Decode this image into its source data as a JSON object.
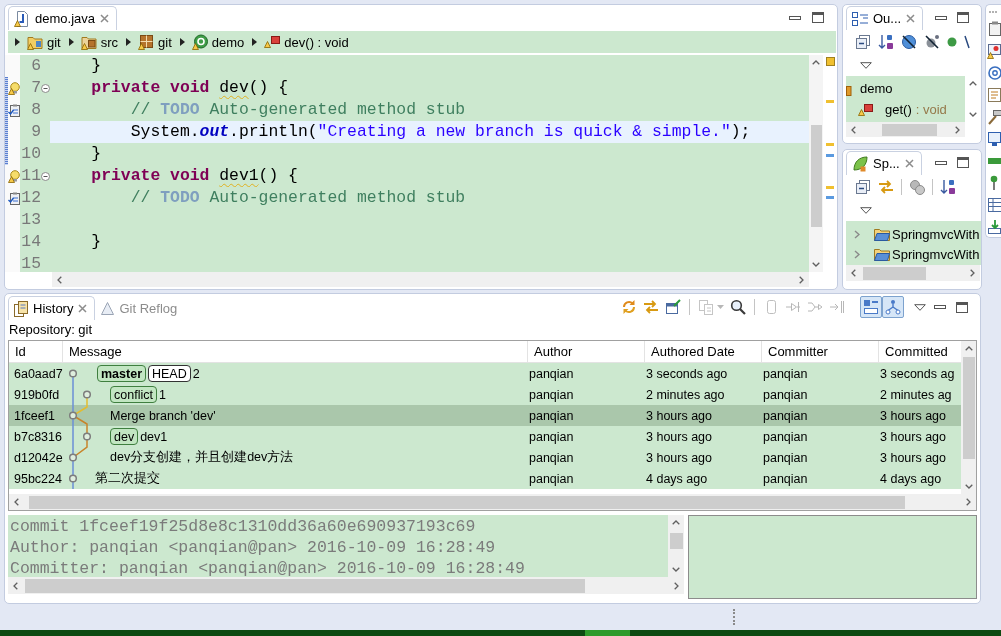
{
  "editor": {
    "tab": {
      "title": "demo.java",
      "selected": true
    },
    "breadcrumb": [
      {
        "kind": "project",
        "label": "git"
      },
      {
        "kind": "source-folder",
        "label": "src"
      },
      {
        "kind": "package",
        "label": "git"
      },
      {
        "kind": "class",
        "label": "demo"
      },
      {
        "kind": "method",
        "label": "dev() : void"
      }
    ],
    "lines": [
      {
        "number": "6",
        "current": false,
        "changed": false,
        "tokens": [
          {
            "kind": "plain",
            "text": "    }"
          }
        ]
      },
      {
        "number": "7",
        "current": false,
        "changed": true,
        "marks": [
          {
            "kind": "warning"
          },
          {
            "kind": "collapse"
          }
        ],
        "tokens": [
          {
            "kind": "keyword",
            "text": "    private void "
          },
          {
            "kind": "warning",
            "text": "dev"
          },
          {
            "kind": "plain",
            "text": "() {"
          }
        ]
      },
      {
        "number": "8",
        "current": false,
        "changed": true,
        "marks": [
          {
            "kind": "task"
          }
        ],
        "tokens": [
          {
            "kind": "comment",
            "text": "        // "
          },
          {
            "kind": "todo",
            "text": "TODO"
          },
          {
            "kind": "comment",
            "text": " Auto-generated method stub"
          }
        ]
      },
      {
        "number": "9",
        "current": true,
        "changed": true,
        "tokens": [
          {
            "kind": "plain",
            "text": "        System."
          },
          {
            "kind": "field",
            "text": "out"
          },
          {
            "kind": "plain",
            "text": ".println("
          },
          {
            "kind": "string",
            "text": "\"Creating a new branch is quick & simple.\""
          },
          {
            "kind": "plain",
            "text": ");"
          }
        ]
      },
      {
        "number": "10",
        "current": false,
        "changed": true,
        "tokens": [
          {
            "kind": "plain",
            "text": "    }"
          }
        ]
      },
      {
        "number": "11",
        "current": false,
        "changed": false,
        "marks": [
          {
            "kind": "warning"
          },
          {
            "kind": "collapse"
          }
        ],
        "tokens": [
          {
            "kind": "keyword",
            "text": "    private void "
          },
          {
            "kind": "warning",
            "text": "dev1"
          },
          {
            "kind": "plain",
            "text": "() {"
          }
        ]
      },
      {
        "number": "12",
        "current": false,
        "changed": false,
        "marks": [
          {
            "kind": "task"
          }
        ],
        "tokens": [
          {
            "kind": "comment",
            "text": "        // "
          },
          {
            "kind": "todo",
            "text": "TODO"
          },
          {
            "kind": "comment",
            "text": " Auto-generated method stub"
          }
        ]
      },
      {
        "number": "13",
        "current": false,
        "changed": false
      },
      {
        "number": "14",
        "current": false,
        "changed": false,
        "tokens": [
          {
            "kind": "plain",
            "text": "    }"
          }
        ]
      },
      {
        "number": "15",
        "current": false,
        "changed": false
      }
    ]
  },
  "outline": {
    "title": "Ou...",
    "items": [
      {
        "kind": "class",
        "name": "demo",
        "children": [
          {
            "kind": "method",
            "name": "get()",
            "type": ": void"
          }
        ]
      }
    ]
  },
  "spring_explorer": {
    "title": "Sp...",
    "items": [
      {
        "label": "SpringmvcWith",
        "expanded": false
      },
      {
        "label": "SpringmvcWith",
        "expanded": false
      }
    ]
  },
  "history": {
    "tabs": [
      {
        "label": "History",
        "selected": true
      },
      {
        "label": "Git Reflog",
        "selected": false
      }
    ],
    "toolbar": [
      {
        "on": false,
        "disabled": false
      },
      {
        "on": false,
        "disabled": false
      },
      {
        "on": false,
        "disabled": false
      },
      {
        "on": false,
        "disabled": true
      },
      {
        "on": false,
        "disabled": false
      },
      {
        "on": false,
        "disabled": true
      },
      {
        "on": false,
        "disabled": true
      },
      {
        "on": false,
        "disabled": true
      },
      {
        "on": false,
        "disabled": true
      },
      {
        "on": true,
        "disabled": false
      },
      {
        "on": true,
        "disabled": false
      }
    ],
    "repository": "Repository: git",
    "columns": [
      "Id",
      "Message",
      "Author",
      "Authored Date",
      "Committer",
      "Committed"
    ],
    "rows": [
      {
        "id": "6a0aad7",
        "refs": [
          {
            "kind": "branch",
            "name": "master",
            "current": true
          },
          {
            "kind": "head",
            "name": "HEAD",
            "current": false
          }
        ],
        "message": "2",
        "author": "panqian",
        "authored_date": "3 seconds ago",
        "committer": "panqian",
        "committed_date": "3 seconds ag",
        "selected": false
      },
      {
        "id": "919b0fd",
        "refs": [
          {
            "kind": "branch",
            "name": "conflict",
            "current": false
          }
        ],
        "message": "1",
        "author": "panqian",
        "authored_date": "2 minutes ago",
        "committer": "panqian",
        "committed_date": "2 minutes ag",
        "selected": false
      },
      {
        "id": "1fceef1",
        "message": "Merge branch 'dev'",
        "author": "panqian",
        "authored_date": "3 hours ago",
        "committer": "panqian",
        "committed_date": "3 hours ago",
        "selected": true
      },
      {
        "id": "b7c8316",
        "refs": [
          {
            "kind": "branch",
            "name": "dev",
            "current": false
          }
        ],
        "message": "dev1",
        "author": "panqian",
        "authored_date": "3 hours ago",
        "committer": "panqian",
        "committed_date": "3 hours ago",
        "selected": false
      },
      {
        "id": "d12042e",
        "message": "dev分支创建，并且创建dev方法",
        "author": "panqian",
        "authored_date": "3 hours ago",
        "committer": "panqian",
        "committed_date": "3 hours ago",
        "selected": false
      },
      {
        "id": "95bc224",
        "message": "第二次提交",
        "author": "panqian",
        "authored_date": "4 days ago",
        "committer": "panqian",
        "committed_date": "4 days ago",
        "selected": false
      }
    ],
    "details": [
      "commit 1fceef19f25d8e8c1310dd36a60e690937193c69",
      "Author: panqian <panqian@pan> 2016-10-09 16:28:49",
      "Committer: panqian <panqian@pan> 2016-10-09 16:28:49"
    ]
  }
}
